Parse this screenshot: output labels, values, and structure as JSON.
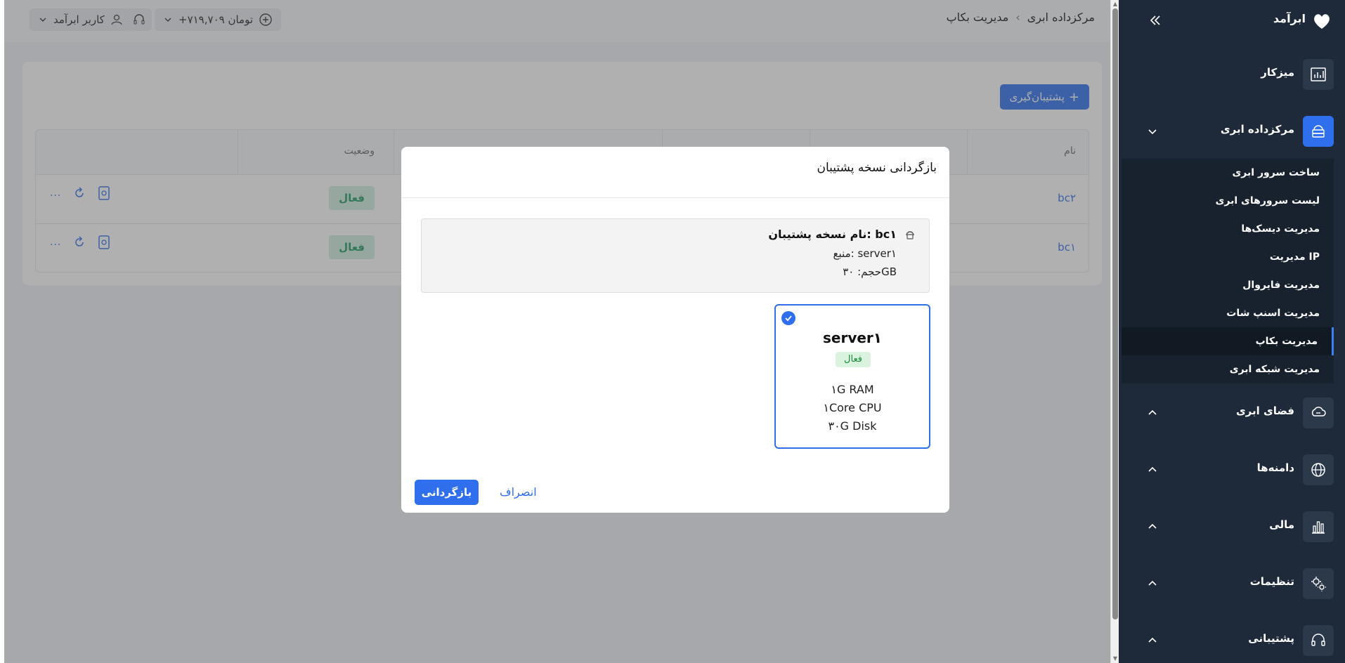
{
  "sidebar": {
    "brand": "ابرآمد",
    "items": [
      {
        "label": "میزکار",
        "icon": "dashboard-chart-icon"
      },
      {
        "label": "مرکزداده ابری",
        "icon": "cloud-datacenter-icon"
      },
      {
        "label": "فضای ابری",
        "icon": "cloud-storage-icon"
      },
      {
        "label": "دامنه‌ها",
        "icon": "globe-icon"
      },
      {
        "label": "مالی",
        "icon": "finance-chart-icon"
      },
      {
        "label": "تنظیمات",
        "icon": "settings-gear-icon"
      },
      {
        "label": "پشتیبانی",
        "icon": "headset-icon"
      }
    ],
    "submenu": [
      {
        "label": "ساخت سرور ابری"
      },
      {
        "label": "لیست سرورهای ابری"
      },
      {
        "label": "مدیریت دیسک‌ها"
      },
      {
        "label": "مدیریت IP"
      },
      {
        "label": "مدیریت فایروال"
      },
      {
        "label": "مدیریت اسنپ شات"
      },
      {
        "label": "مدیریت بکاپ"
      },
      {
        "label": "مدیریت شبکه ابری"
      }
    ]
  },
  "header": {
    "breadcrumb": [
      "مرکزداده ابری",
      "مدیریت بکاپ"
    ],
    "balance": "+۷۱۹,۷۰۹ تومان",
    "user": "کاربر ابرآمد"
  },
  "page": {
    "add_button": "پشتیبان‌گیری",
    "columns": {
      "name": "نام",
      "status": "وضعیت"
    },
    "rows": [
      {
        "name": "bc۲",
        "status": "فعال",
        "more": "..."
      },
      {
        "name": "bc۱",
        "status": "فعال",
        "more": "..."
      }
    ]
  },
  "modal": {
    "title": "بازگردانی نسخه پشتیبان",
    "backup_name": "نام نسخه پشتیبان: bc۱",
    "source": "منبع: server۱",
    "size": "حجم: ۳۰GB",
    "server": {
      "name": "server۱",
      "status": "فعال",
      "ram": "۱G RAM",
      "cpu": "۱Core CPU",
      "disk": "۳۰G Disk"
    },
    "restore_button": "بازگردانی",
    "cancel_button": "انصراف"
  },
  "colors": {
    "accent": "#2f6fed",
    "sidebar_bg": "#1e2a39",
    "active_badge_bg": "#cfeee0",
    "active_badge_text": "#1e9a63"
  }
}
